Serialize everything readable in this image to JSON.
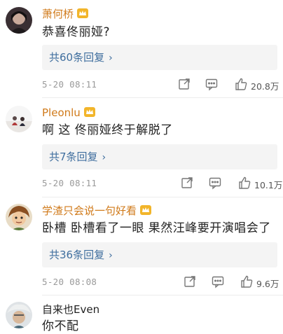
{
  "comments": [
    {
      "username": "萧何桥",
      "text": "恭喜佟丽娅?",
      "replies": "共60条回复",
      "time": "5-20 08:11",
      "likes": "20.8万"
    },
    {
      "username": "Pleonlu",
      "text": "啊 这  佟丽娅终于解脱了",
      "replies": "共7条回复",
      "time": "5-20 08:11",
      "likes": "10.1万"
    },
    {
      "username": "学渣只会说一句好看",
      "text": "卧槽  卧槽看了一眼 果然汪峰要开演唱会了",
      "replies": "共36条回复",
      "time": "5-20 08:08",
      "likes": "9.6万"
    },
    {
      "username": "自来也Even",
      "text": "你不配"
    }
  ],
  "icons": {
    "chevron": "chevron-right-icon",
    "share": "share-icon",
    "reply": "comment-icon",
    "like": "thumbs-up-icon",
    "badge": "crown-badge-icon"
  },
  "colors": {
    "username": "#d07a1a",
    "link": "#3f6e9e",
    "meta": "#9a9a9a",
    "reply_bg": "#f4f4f4"
  }
}
